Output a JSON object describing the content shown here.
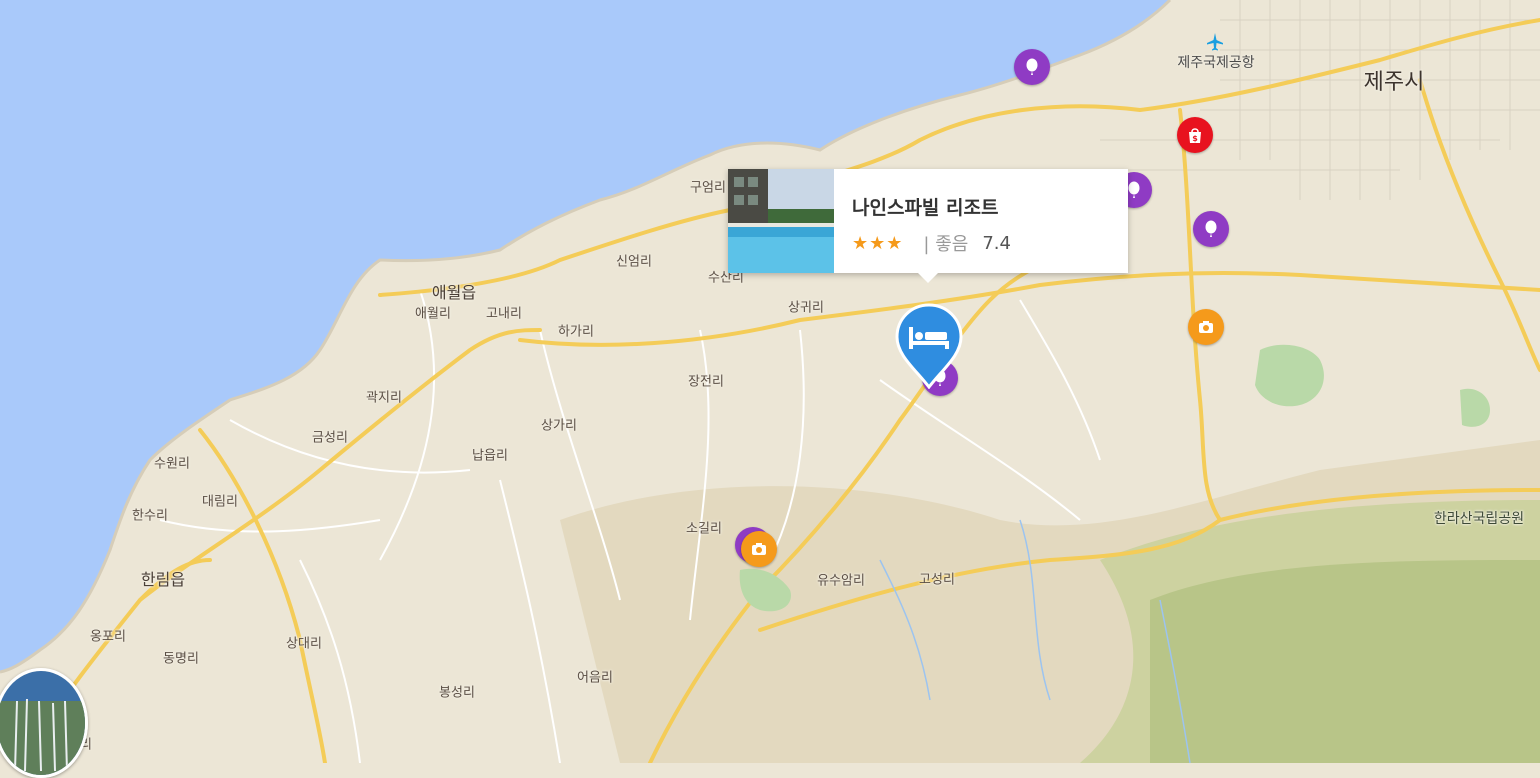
{
  "map": {
    "places": [
      {
        "name": "제주시",
        "class": "city"
      },
      {
        "name": "제주국제공항",
        "class": "airport"
      },
      {
        "name": "애월읍",
        "class": "town"
      },
      {
        "name": "한림읍",
        "class": "town"
      },
      {
        "name": "한라산국립공원",
        "class": "park"
      },
      {
        "name": "구엄리",
        "class": "village"
      },
      {
        "name": "신엄리",
        "class": "village"
      },
      {
        "name": "수산리",
        "class": "village"
      },
      {
        "name": "애월리",
        "class": "village"
      },
      {
        "name": "고내리",
        "class": "village"
      },
      {
        "name": "하가리",
        "class": "village"
      },
      {
        "name": "상귀리",
        "class": "village"
      },
      {
        "name": "장전리",
        "class": "village"
      },
      {
        "name": "곽지리",
        "class": "village"
      },
      {
        "name": "금성리",
        "class": "village"
      },
      {
        "name": "상가리",
        "class": "village"
      },
      {
        "name": "납읍리",
        "class": "village"
      },
      {
        "name": "수원리",
        "class": "village"
      },
      {
        "name": "대림리",
        "class": "village"
      },
      {
        "name": "한수리",
        "class": "village"
      },
      {
        "name": "소길리",
        "class": "village"
      },
      {
        "name": "유수암리",
        "class": "village"
      },
      {
        "name": "고성리",
        "class": "village"
      },
      {
        "name": "옹포리",
        "class": "village"
      },
      {
        "name": "동명리",
        "class": "village"
      },
      {
        "name": "상대리",
        "class": "village"
      },
      {
        "name": "봉성리",
        "class": "village"
      },
      {
        "name": "어음리",
        "class": "village"
      },
      {
        "name": "리",
        "class": "village"
      }
    ],
    "markers": [
      {
        "type": "balloon",
        "color": "#8f3bc4"
      },
      {
        "type": "shopping",
        "color": "#e8121f"
      },
      {
        "type": "balloon",
        "color": "#8f3bc4"
      },
      {
        "type": "balloon",
        "color": "#8f3bc4"
      },
      {
        "type": "camera",
        "color": "#f59a1b"
      },
      {
        "type": "balloon",
        "color": "#8f3bc4"
      },
      {
        "type": "balloon",
        "color": "#8f3bc4"
      },
      {
        "type": "camera",
        "color": "#f59a1b"
      }
    ],
    "colors": {
      "sea": "#a9c9fa",
      "land": "#ece6d6",
      "road_major": "#f7d25c",
      "park": "#b9c98e",
      "hotel_pin": "#2f8de0"
    }
  },
  "popup": {
    "title": "나인스파빌 리조트",
    "stars": "★★★",
    "rating_label": "| 좋음",
    "rating_value": "7.4"
  }
}
